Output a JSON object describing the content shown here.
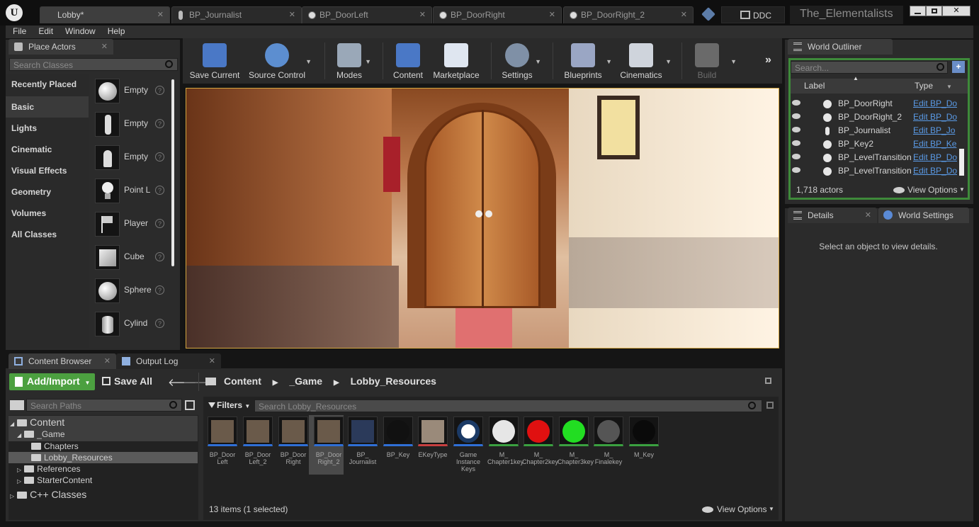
{
  "window": {
    "project_name": "The_Elementalists",
    "ddc_label": "DDC",
    "tabs": [
      "Lobby*",
      "BP_Journalist",
      "BP_DoorLeft",
      "BP_DoorRight",
      "BP_DoorRight_2"
    ]
  },
  "menu": [
    "File",
    "Edit",
    "Window",
    "Help"
  ],
  "place_actors": {
    "tab_label": "Place Actors",
    "search_placeholder": "Search Classes",
    "categories": [
      "Recently Placed",
      "Basic",
      "Lights",
      "Cinematic",
      "Visual Effects",
      "Geometry",
      "Volumes",
      "All Classes"
    ],
    "selected_category": "Basic",
    "items": [
      "Empty",
      "Empty",
      "Empty",
      "Point L",
      "Player",
      "Cube",
      "Sphere",
      "Cylind"
    ]
  },
  "toolbar": {
    "buttons": [
      "Save Current",
      "Source Control",
      "Modes",
      "Content",
      "Marketplace",
      "Settings",
      "Blueprints",
      "Cinematics",
      "Build"
    ]
  },
  "world_outliner": {
    "tab_label": "World Outliner",
    "search_placeholder": "Search...",
    "col_label": "Label",
    "col_type": "Type",
    "rows": [
      {
        "label": "BP_DoorRight",
        "type": "Edit BP_Do"
      },
      {
        "label": "BP_DoorRight_2",
        "type": "Edit BP_Do"
      },
      {
        "label": "BP_Journalist",
        "type": "Edit BP_Jo"
      },
      {
        "label": "BP_Key2",
        "type": "Edit BP_Ke"
      },
      {
        "label": "BP_LevelTransition",
        "type": "Edit BP_Do"
      },
      {
        "label": "BP_LevelTransition",
        "type": "Edit BP_Do"
      }
    ],
    "actor_count": "1,718 actors",
    "view_options": "View Options"
  },
  "details": {
    "tab_label": "Details",
    "world_settings_label": "World Settings",
    "empty_message": "Select an object to view details."
  },
  "content_browser": {
    "tab_label": "Content Browser",
    "output_log_label": "Output Log",
    "add_import": "Add/Import",
    "save_all": "Save All",
    "breadcrumb": [
      "Content",
      "_Game",
      "Lobby_Resources"
    ],
    "search_paths_placeholder": "Search Paths",
    "filters_label": "Filters",
    "search_placeholder": "Search Lobby_Resources",
    "tree": [
      "Content",
      "_Game",
      "Chapters",
      "Lobby_Resources",
      "References",
      "StarterContent",
      "C++ Classes"
    ],
    "assets": [
      {
        "name": "BP_Door Left",
        "color": "#6a5a4a"
      },
      {
        "name": "BP_Door Left_2",
        "color": "#6a5a4a"
      },
      {
        "name": "BP_Door Right",
        "color": "#6a5a4a"
      },
      {
        "name": "BP_Door Right_2",
        "color": "#6a5a4a"
      },
      {
        "name": "BP_ Journalist",
        "color": "#2b3a5a"
      },
      {
        "name": "BP_Key",
        "color": "#111111"
      },
      {
        "name": "EKeyType",
        "color": "#9a8a7a"
      },
      {
        "name": "Game Instance Keys",
        "color": "#1b3a66"
      },
      {
        "name": "M_ Chapter1key",
        "color": "#e6e6e6"
      },
      {
        "name": "M_ Chapter2key",
        "color": "#e01010"
      },
      {
        "name": "M_ Chapter3key",
        "color": "#22dd22"
      },
      {
        "name": "M_ Finalekey",
        "color": "#555555"
      },
      {
        "name": "M_Key",
        "color": "#0a0a0a"
      }
    ],
    "status": "13 items (1 selected)",
    "view_options": "View Options"
  }
}
